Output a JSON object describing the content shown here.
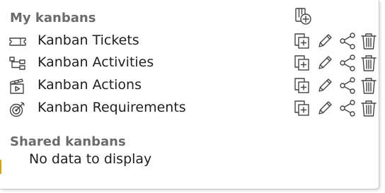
{
  "my_kanbans": {
    "title": "My kanbans",
    "add_icon": "add-kanban-icon",
    "items": [
      {
        "label": "Kanban Tickets",
        "icon": "ticket-icon"
      },
      {
        "label": "Kanban Activities",
        "icon": "hierarchy-icon"
      },
      {
        "label": "Kanban Actions",
        "icon": "clapperboard-play-icon"
      },
      {
        "label": "Kanban Requirements",
        "icon": "target-icon"
      }
    ],
    "row_actions": [
      "copy-icon",
      "edit-icon",
      "share-icon",
      "delete-icon"
    ]
  },
  "shared_kanbans": {
    "title": "Shared kanbans",
    "empty_message": "No data to display"
  },
  "colors": {
    "section_title": "#6b6b6b",
    "text": "#1f1f1f",
    "icon_stroke": "#444444",
    "accent": "#d9a400"
  }
}
